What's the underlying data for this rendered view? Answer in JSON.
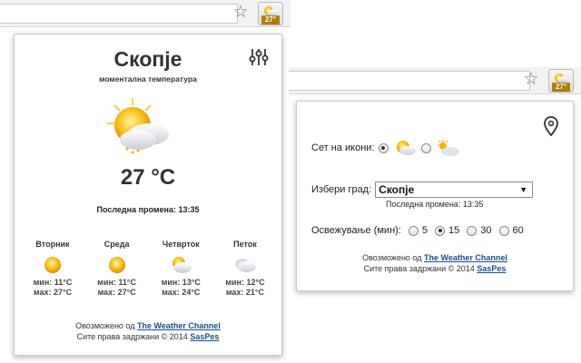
{
  "toolbar": {
    "star_icon": "star-icon",
    "ext_badge": "27°"
  },
  "popup_main": {
    "city": "Скопје",
    "subtitle": "моментална температура",
    "current_icon": "partly-cloudy-sun-icon",
    "temperature": "27 °C",
    "last_update": "Последна промена: 13:35",
    "forecast": [
      {
        "day": "Вторник",
        "icon": "sun-icon",
        "min": "мин: 11°C",
        "max": "мах: 27°C"
      },
      {
        "day": "Среда",
        "icon": "sun-icon",
        "min": "мин: 11°C",
        "max": "мах: 27°C"
      },
      {
        "day": "Четврток",
        "icon": "partly-cloudy-icon",
        "min": "мин: 13°C",
        "max": "мах: 24°C"
      },
      {
        "day": "Петок",
        "icon": "cloudy-icon",
        "min": "мин: 12°C",
        "max": "мах: 21°C"
      }
    ],
    "footer_prefix": "Овозможено од",
    "footer_link": "The Weather Channel",
    "copyright_prefix": "Сите права задржани © 2014",
    "copyright_link": "SasPes"
  },
  "popup_settings": {
    "icon_set_label": "Сет на икони:",
    "icon_set_selected": 0,
    "city_label": "Избери град:",
    "city_value": "Скопје",
    "last_update": "Последна промена: 13:35",
    "refresh_label": "Освежување (мин):",
    "refresh_options": [
      "5",
      "15",
      "30",
      "60"
    ],
    "refresh_selected": 1,
    "footer_prefix": "Овозможено од",
    "footer_link": "The Weather Channel",
    "copyright_prefix": "Сите права задржани © 2014",
    "copyright_link": "SasPes"
  },
  "colors": {
    "sun": "#f5b40a",
    "badge": "#b07d05",
    "link": "#1a4f8a"
  }
}
